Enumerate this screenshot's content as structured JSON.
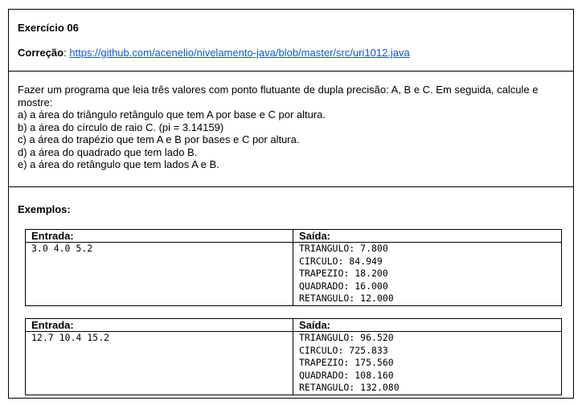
{
  "header": {
    "title": "Exercício 06",
    "correction_label": "Correção",
    "correction_separator": ":",
    "correction_link": "https://github.com/acenelio/nivelamento-java/blob/master/src/uri1012.java"
  },
  "statement": {
    "intro": "Fazer um programa que leia três valores com ponto flutuante de dupla precisão: A, B e C. Em seguida, calcule e mostre:",
    "items": [
      "a) a área do triângulo retângulo que tem A por base e C por altura.",
      "b) a área do círculo de raio C. (pi = 3.14159)",
      "c) a área do trapézio que tem A e B por bases e C por altura.",
      "d) a área do quadrado que tem lado B.",
      "e) a área do retângulo que tem lados A e B."
    ]
  },
  "examples": {
    "label": "Exemplos:",
    "input_header": "Entrada:",
    "output_header": "Saída:",
    "list": [
      {
        "input": "3.0 4.0 5.2",
        "output": [
          "TRIANGULO: 7.800",
          "CIRCULO: 84.949",
          "TRAPEZIO: 18.200",
          "QUADRADO: 16.000",
          "RETANGULO: 12.000"
        ]
      },
      {
        "input": "12.7 10.4 15.2",
        "output": [
          "TRIANGULO: 96.520",
          "CIRCULO: 725.833",
          "TRAPEZIO: 175.560",
          "QUADRADO: 108.160",
          "RETANGULO: 132.080"
        ]
      }
    ]
  }
}
